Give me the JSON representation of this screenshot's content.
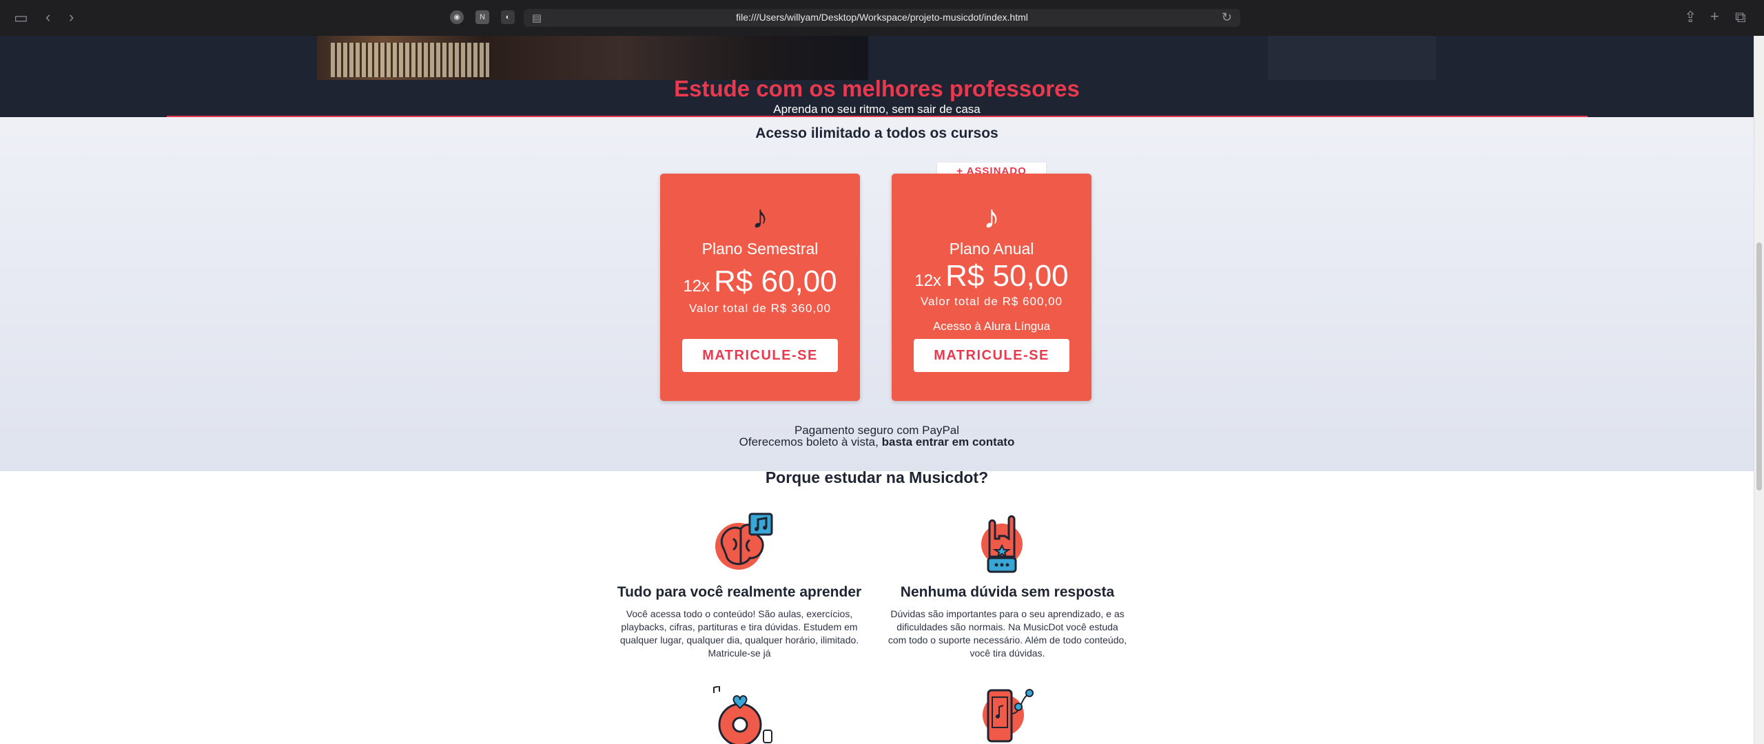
{
  "browser": {
    "url": "file:///Users/willyam/Desktop/Workspace/projeto-musicdot/index.html"
  },
  "hero": {
    "title": "Estude com os melhores professores",
    "subtitle": "Aprenda no seu ritmo, sem sair de casa"
  },
  "plans": {
    "heading": "Acesso ilimitado a todos os cursos",
    "items": [
      {
        "name": "Plano Semestral",
        "installments": "12x",
        "price": "R$ 60,00",
        "total": "Valor total de R$ 360,00",
        "extra": "",
        "button": "MATRICULE-SE"
      },
      {
        "name": "Plano Anual",
        "installments": "12x",
        "price": "R$ 50,00",
        "total": "Valor total de R$ 600,00",
        "extra": "Acesso à Alura Língua",
        "button": "MATRICULE-SE",
        "tag": "+ ASSINADO"
      }
    ],
    "payment_line": "Pagamento seguro com PayPal",
    "boleto_text": "Oferecemos boleto à vista,",
    "boleto_link": "basta entrar em contato"
  },
  "why": {
    "heading": "Porque estudar na Musicdot?",
    "features": [
      {
        "title": "Tudo para você realmente aprender",
        "text": "Você acessa todo o conteúdo! São aulas, exercícios, playbacks, cifras, partituras e tira dúvidas. Estudem em qualquer lugar, qualquer dia, qualquer horário, ilimitado. Matricule-se já",
        "icon": "brain-music-icon"
      },
      {
        "title": "Nenhuma dúvida sem resposta",
        "text": "Dúvidas são importantes para o seu aprendizado, e as dificuldades são normais. Na MusicDot você estuda com todo o suporte necessário. Além de todo conteúdo, você tira dúvidas.",
        "icon": "rock-hand-icon"
      }
    ],
    "more_icons": [
      "vinyl-music-icon",
      "phone-music-icon"
    ]
  },
  "colors": {
    "accent": "#e8394f",
    "card": "#f05a48",
    "navy": "#1f2433"
  }
}
